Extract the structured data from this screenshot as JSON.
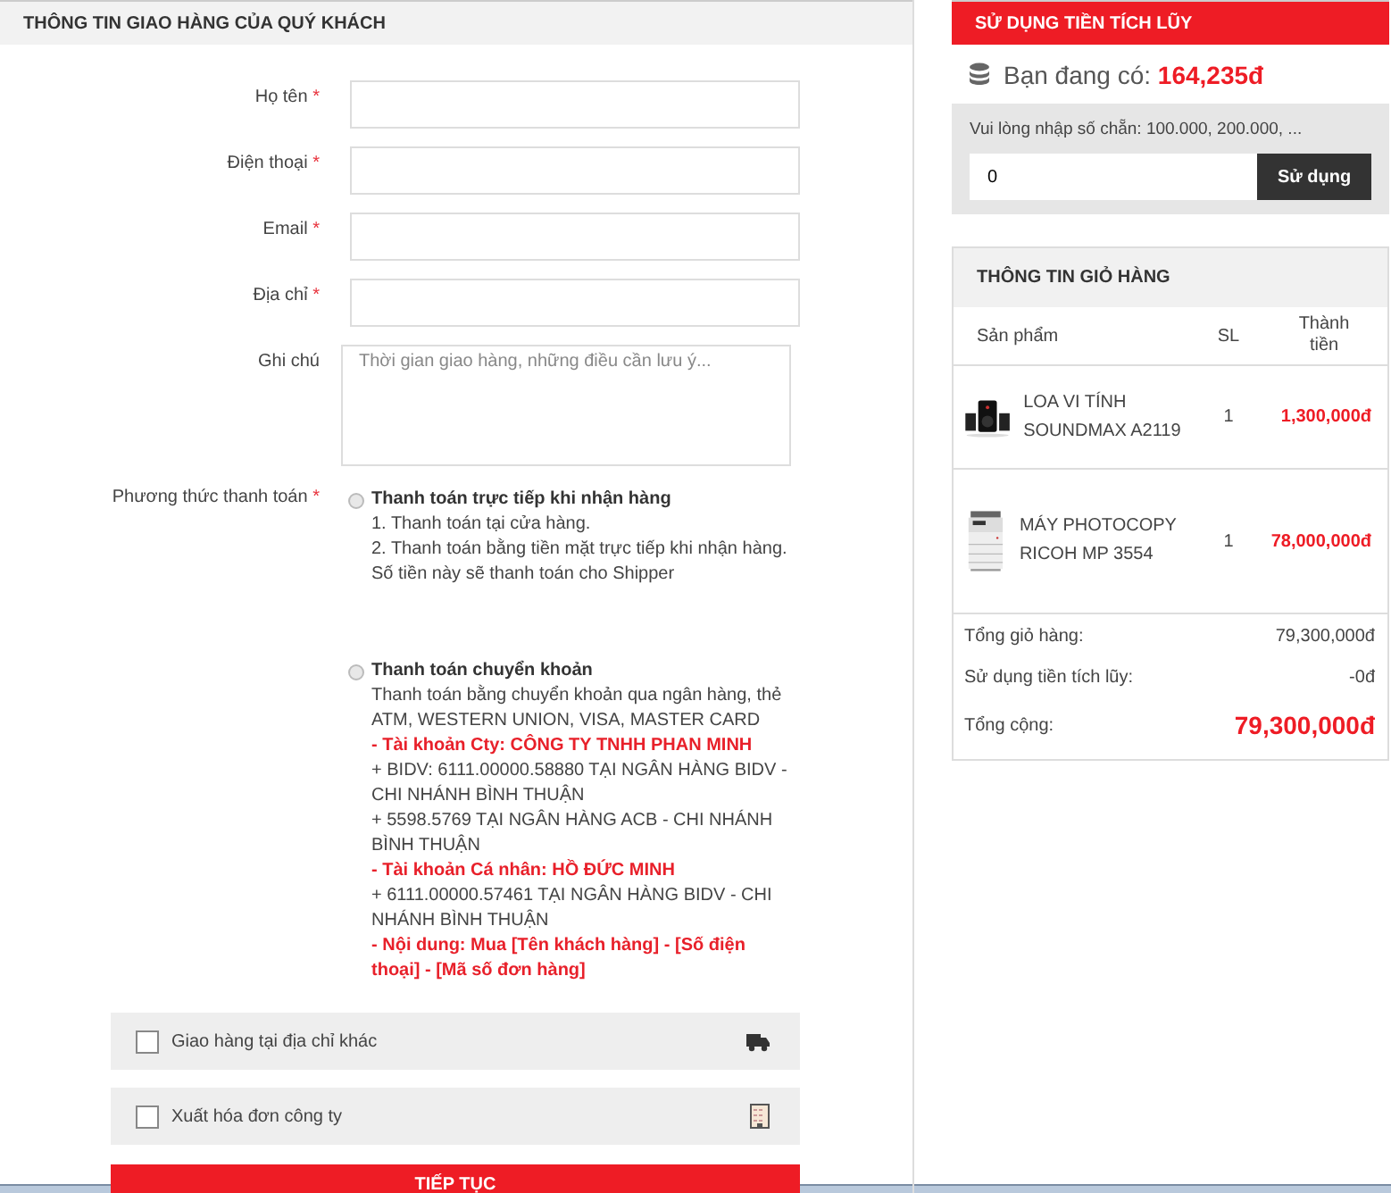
{
  "shipping": {
    "title": "THÔNG TIN GIAO HÀNG CỦA QUÝ KHÁCH",
    "fields": [
      {
        "label": "Họ tên",
        "mark": "*",
        "kind": "input"
      },
      {
        "label": "Điện thoại",
        "mark": "*",
        "kind": "input"
      },
      {
        "label": "Email",
        "mark": "*",
        "kind": "input"
      },
      {
        "label": "Địa chỉ",
        "mark": "*",
        "kind": "input"
      },
      {
        "label": "Ghi chú",
        "kind": "textarea",
        "placeholder": "Thời gian giao hàng, những điều cần lưu ý..."
      }
    ],
    "payment": {
      "label": "Phương thức thanh toán",
      "mark": "*",
      "methods": [
        {
          "title": "Thanh toán trực tiếp khi nhận hàng",
          "selected": false,
          "lines": [
            {
              "text": "1. Thanh toán  tại cửa hàng.",
              "kind": "plain"
            },
            {
              "text": "2. Thanh toán bằng tiền mặt trực tiếp khi nhận hàng. Số tiền này sẽ thanh toán cho Shipper",
              "kind": "plain"
            }
          ]
        },
        {
          "title": "Thanh toán chuyển khoản",
          "selected": false,
          "lines": [
            {
              "text": "Thanh toán bằng chuyển khoản qua ngân hàng, thẻ ATM, WESTERN UNION, VISA, MASTER CARD",
              "kind": "plain"
            },
            {
              "text": "- Tài khoản Cty: CÔNG TY TNHH PHAN MINH",
              "kind": "highlight"
            },
            {
              "text": "+ BIDV: 6111.00000.58880 TẠI NGÂN HÀNG BIDV - CHI NHÁNH BÌNH THUẬN",
              "kind": "plain"
            },
            {
              "text": "+ 5598.5769 TẠI NGÂN HÀNG ACB - CHI NHÁNH BÌNH THUẬN",
              "kind": "plain"
            },
            {
              "text": "- Tài khoản Cá nhân: HỒ ĐỨC MINH",
              "kind": "highlight"
            },
            {
              "text": "+ 6111.00000.57461 TẠI NGÂN HÀNG BIDV -  CHI NHÁNH BÌNH THUẬN",
              "kind": "plain"
            },
            {
              "text": "- Nội dung: Mua [Tên khách hàng] - [Số điện thoại] - [Mã số đơn hàng]",
              "kind": "highlight"
            }
          ]
        }
      ]
    },
    "options": [
      {
        "label": "Giao hàng tại địa chỉ khác",
        "checked": false,
        "kind": "truck"
      },
      {
        "label": "Xuất hóa đơn công ty",
        "checked": false,
        "kind": "invoice"
      }
    ],
    "continue_button": "TIẾP TỤC"
  },
  "wallet": {
    "title": "SỬ DỤNG TIỀN TÍCH LŨY",
    "balance_label": "Bạn đang có:",
    "balance": "164,235đ",
    "hint": "Vui lòng nhập số chẵn: 100.000, 200.000, ...",
    "amount": "0",
    "button": "Sử dụng"
  },
  "cart": {
    "title": "THÔNG TIN GIỎ HÀNG",
    "columns": [
      "Sản phẩm",
      "SL",
      "Thành tiền"
    ],
    "rows": [
      {
        "name": "LOA VI TÍNH SOUNDMAX A2119",
        "qty": "1",
        "price": "1,300,000đ",
        "kind": "speaker"
      },
      {
        "name": "MÁY PHOTOCOPY RICOH MP 3554",
        "qty": "1",
        "price": "78,000,000đ",
        "kind": "copier"
      }
    ],
    "totals": [
      {
        "label": "Tổng giỏ hàng:",
        "value": "79,300,000đ",
        "kind": "plain"
      },
      {
        "label": "Sử dụng tiền tích lũy:",
        "value": "-0đ",
        "kind": "plain"
      },
      {
        "label": "Tổng cộng:",
        "value": "79,300,000đ",
        "kind": "grand"
      }
    ]
  }
}
